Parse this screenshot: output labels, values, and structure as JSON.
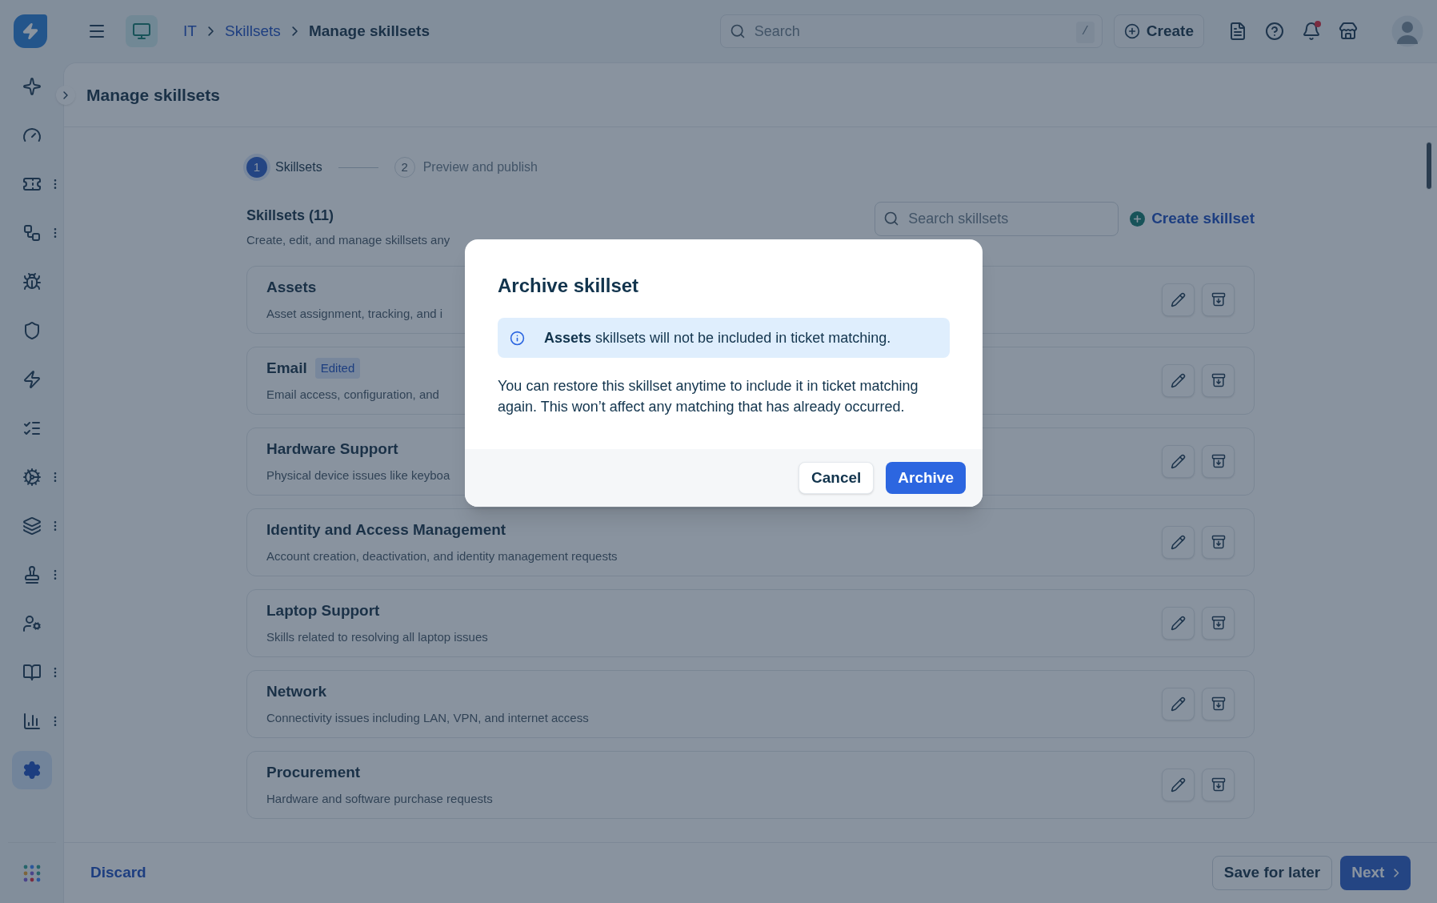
{
  "topbar": {
    "breadcrumbs": [
      {
        "label": "IT",
        "link": true
      },
      {
        "label": "Skillsets",
        "link": true
      },
      {
        "label": "Manage skillsets",
        "link": false
      }
    ],
    "search": {
      "placeholder": "Search",
      "shortcut": "/"
    },
    "create_button": "Create",
    "notifications": {
      "unread": true
    }
  },
  "sidebar": {
    "items": [
      {
        "selected": false,
        "menu": false
      },
      {
        "selected": false,
        "menu": false
      },
      {
        "selected": false,
        "menu": true
      },
      {
        "selected": false,
        "menu": true
      },
      {
        "selected": false,
        "menu": false
      },
      {
        "selected": false,
        "menu": false
      },
      {
        "selected": false,
        "menu": false
      },
      {
        "selected": false,
        "menu": false
      },
      {
        "selected": false,
        "menu": true
      },
      {
        "selected": false,
        "menu": true
      },
      {
        "selected": false,
        "menu": true
      },
      {
        "selected": false,
        "menu": false
      },
      {
        "selected": false,
        "menu": true
      },
      {
        "selected": false,
        "menu": true
      },
      {
        "selected": true,
        "menu": false
      }
    ]
  },
  "page_title": "Manage skillsets",
  "steps": [
    {
      "number": "1",
      "label": "Skillsets",
      "selected": true
    },
    {
      "number": "2",
      "label": "Preview and publish",
      "selected": false
    }
  ],
  "skillsets_header": {
    "title": "Skillsets (11)",
    "subtitle": "Create, edit, and manage skillsets any",
    "search_placeholder": "Search skillsets",
    "create_link": "Create skillset"
  },
  "skillsets": [
    {
      "name": "Assets",
      "description": "Asset assignment, tracking, and i"
    },
    {
      "name": "Email",
      "description": "Email access, configuration, and",
      "badge": "Edited"
    },
    {
      "name": "Hardware Support",
      "description": "Physical device issues like keyboa"
    },
    {
      "name": "Identity and Access Management",
      "description": "Account creation, deactivation, and identity management requests"
    },
    {
      "name": "Laptop Support",
      "description": "Skills related to resolving all laptop issues"
    },
    {
      "name": "Network",
      "description": "Connectivity issues including LAN, VPN, and internet access"
    },
    {
      "name": "Procurement",
      "description": "Hardware and software purchase requests"
    }
  ],
  "footer": {
    "discard": "Discard",
    "save": "Save for later",
    "next": "Next"
  },
  "dialog": {
    "title": "Archive skillset",
    "notice": "**Assets** skillsets will not be included in ticket matching.",
    "body": "You can restore this skillset anytime to include it in ticket matching again. This won’t affect any matching that has already occurred.",
    "buttons": [
      {
        "label": "Cancel",
        "kind": "secondary"
      },
      {
        "label": "Archive",
        "kind": "primary"
      }
    ]
  }
}
